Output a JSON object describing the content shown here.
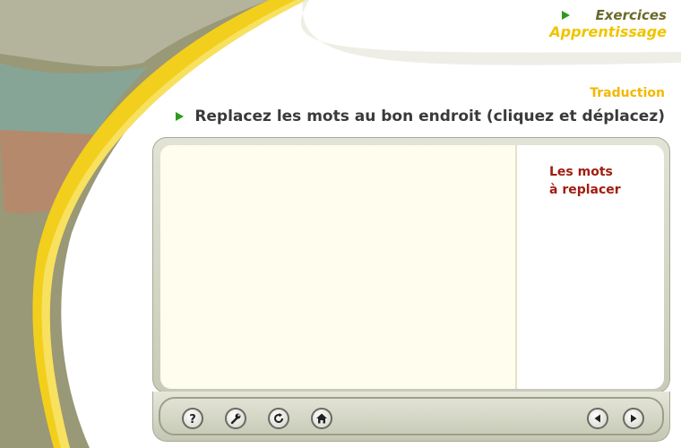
{
  "header": {
    "exercises_label": "Exercices",
    "learning_label": "Apprentissage"
  },
  "section": {
    "label": "Traduction"
  },
  "instruction": {
    "text": "Replacez les mots au bon endroit (cliquez et déplacez)"
  },
  "words_panel": {
    "title": "Les mots\nà replacer"
  },
  "toolbar": {
    "buttons": [
      "help-icon",
      "wrench-icon",
      "refresh-icon",
      "home-icon"
    ],
    "navigation": [
      "previous-icon",
      "next-icon"
    ]
  },
  "colors": {
    "accent_green": "#2e9a1a",
    "brand_yellow": "#f0c400",
    "title_red": "#a01e10",
    "workspace_bg": "#fffdee"
  }
}
